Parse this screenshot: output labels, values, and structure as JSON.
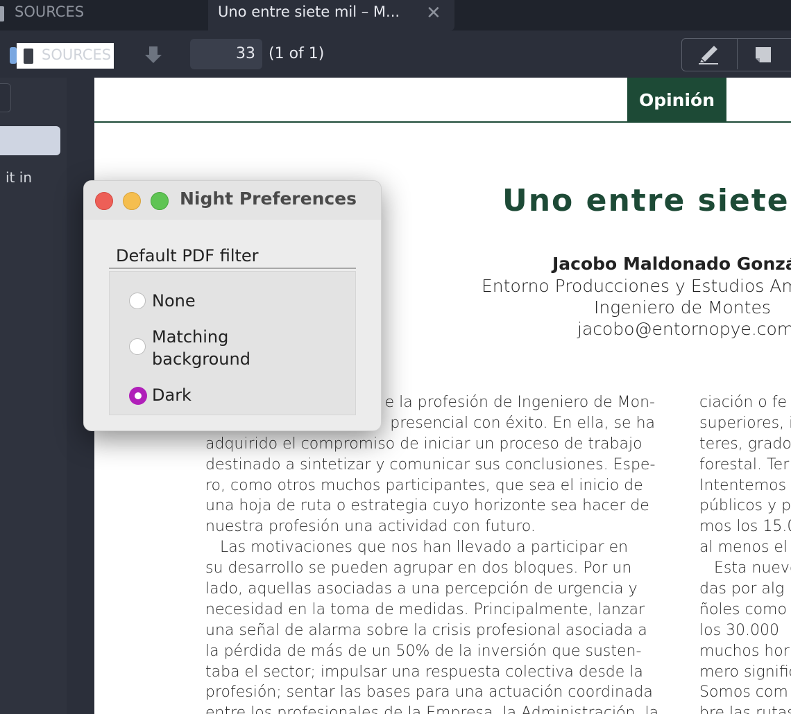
{
  "tabs": {
    "left_label": "SOURCES",
    "active_title": "Uno entre siete mil – M..."
  },
  "toolbar": {
    "sources_label": "SOURCES",
    "page_number": "33",
    "page_count": "(1 of 1)"
  },
  "sidebar": {
    "snippet": "it in"
  },
  "document": {
    "section_tag": "Opinión",
    "title": "Uno entre siete",
    "author_name": "Jacobo Maldonado Gonzále",
    "affiliation": "Entorno Producciones y Estudios Ambie",
    "role": "Ingeniero de Montes",
    "email": "jacobo@entornopye.com",
    "column1": [
      "e la profesión de Ingeniero de Mon-",
      "presencial con éxito. En ella, se ha",
      "adquirido el compromiso de iniciar un proceso de trabajo",
      "destinado a sintetizar y comunicar sus conclusiones. Espe-",
      "ro, como otros muchos participantes, que sea el inicio de",
      "una hoja de ruta o estrategia cuyo horizonte sea hacer de",
      "nuestra profesión una actividad con futuro.",
      "   Las motivaciones que nos han llevado a participar en",
      "su desarrollo se pueden agrupar en dos bloques. Por un",
      "lado, aquellas asociadas a una percepción de urgencia y",
      "necesidad en la toma de medidas. Principalmente, lanzar",
      "una señal de alarma sobre la crisis profesional asociada a",
      "la pérdida de más de un 50% de la inversión que susten-",
      "taba el sector; impulsar una respuesta colectiva desde la",
      "profesión; sentar las bases para una actuación coordinada",
      "entre los profesionales de la Empresa, la Administración, la"
    ],
    "column2": [
      "ciación o fe",
      "superiores, i",
      "teres, grado",
      "forestal. Ter",
      "Intentemos s",
      "públicos y p",
      "mos los 15.0",
      "al menos el",
      "   Esta nuevo",
      "das por alg",
      "ñoles como",
      "los 30.000",
      "muchos hori",
      "mero signific",
      "Somos com",
      "bre las rutas"
    ]
  },
  "dialog": {
    "title": "Night Preferences",
    "section_label": "Default PDF filter",
    "options": [
      {
        "label_line1": "None",
        "label_line2": "",
        "selected": false
      },
      {
        "label_line1": "Matching",
        "label_line2": "background",
        "selected": false
      },
      {
        "label_line1": "Dark",
        "label_line2": "",
        "selected": true
      }
    ]
  },
  "colors": {
    "accent_radio": "#b01fb9",
    "brand_green": "#1d4a36"
  }
}
